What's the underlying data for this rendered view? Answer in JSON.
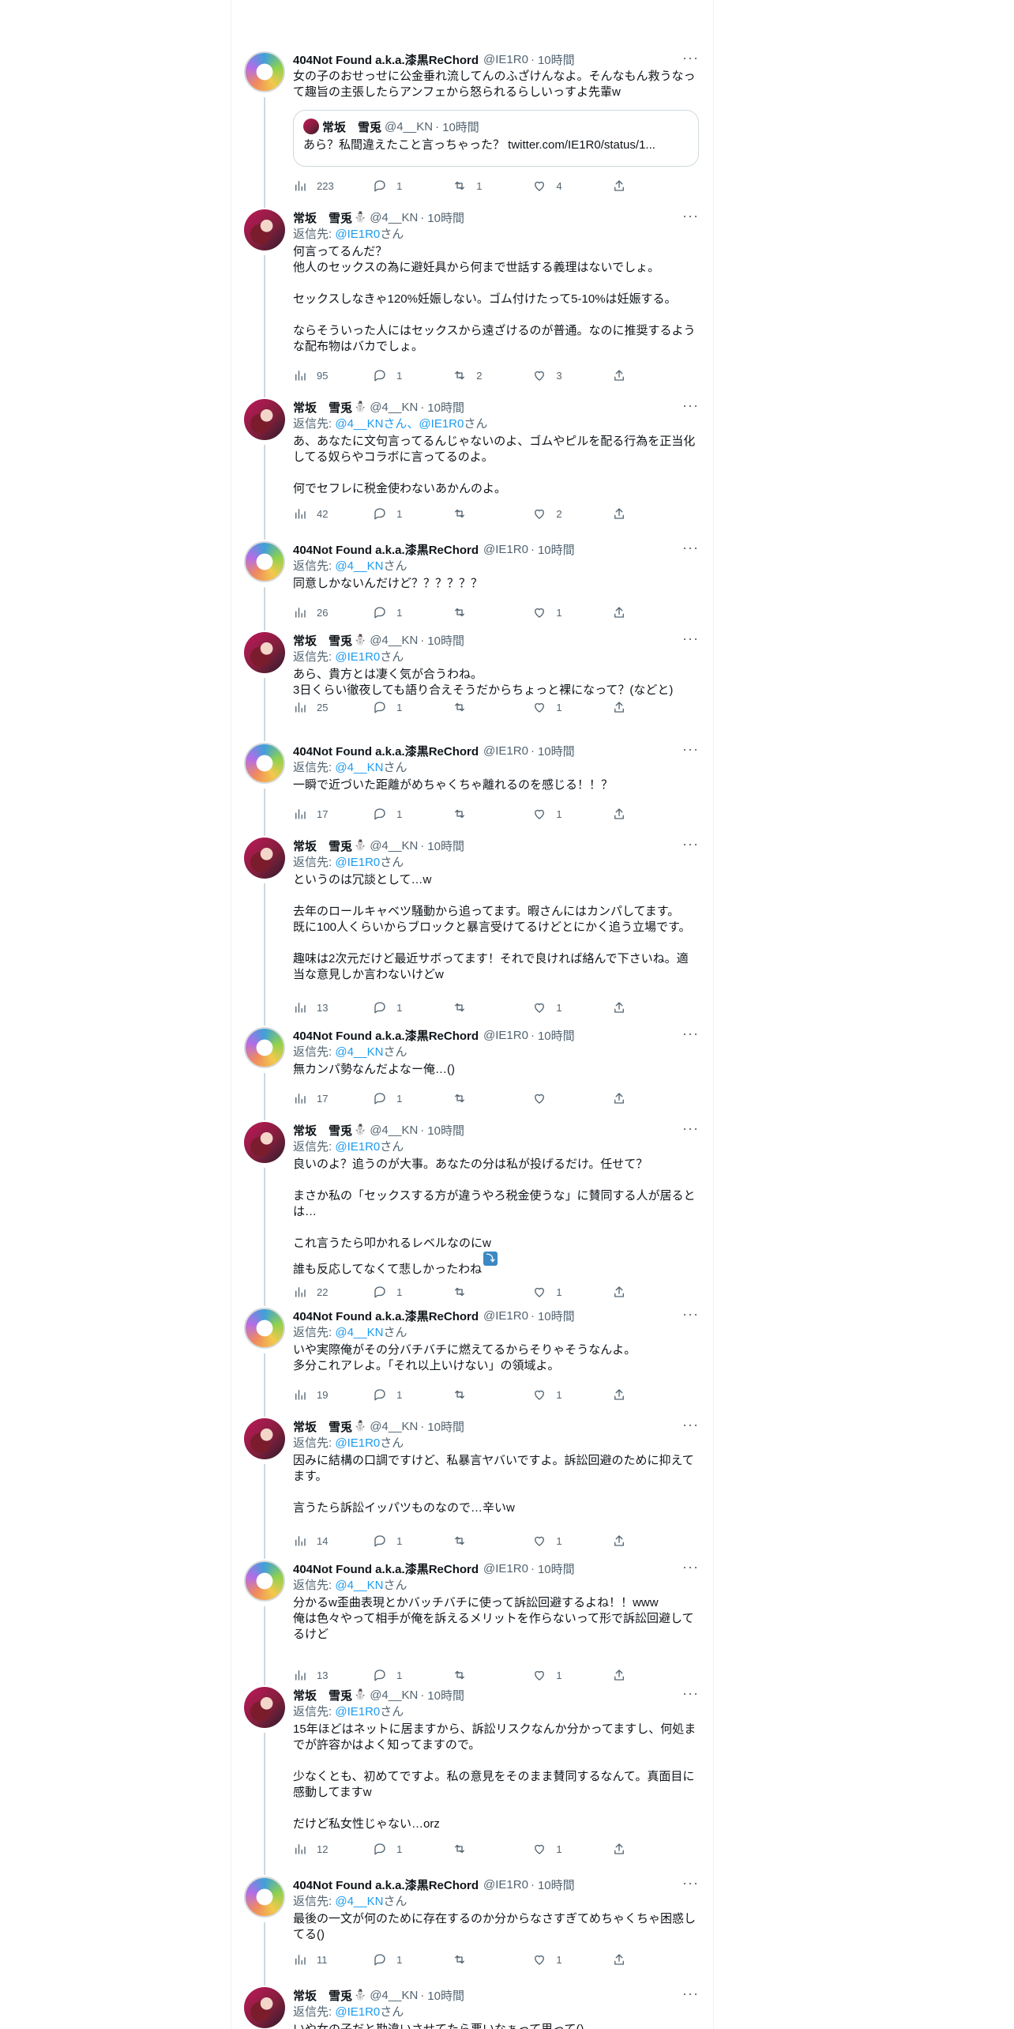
{
  "tweets": [
    {
      "name": "404Not Found a.k.a.漆黒ReChord",
      "badge": "",
      "handle": "@IE1R0",
      "time": "10時間",
      "reply_to": null,
      "text": "女の子のおせっせに公金垂れ流してんのふざけんなよ。そんなもん救うなって趣旨の主張したらアンフェから怒られるらしいっすよ先輩w",
      "quote": {
        "name": "常坂　雪兎",
        "handle": "@4__KN",
        "time": "10時間",
        "text": "あら？私間違えたこと言っちゃった？ twitter.com/IE1R0/status/1..."
      },
      "stats": {
        "views": "223",
        "replies": "1",
        "retweets": "1",
        "likes": "4"
      }
    },
    {
      "name": "常坂　雪兎",
      "badge": "⛄",
      "handle": "@4__KN",
      "time": "10時間",
      "reply_to": {
        "prefix": "返信先: ",
        "mentions": "@IE1R0",
        "suffix": "さん"
      },
      "text": "何言ってるんだ？\n他人のセックスの為に避妊具から何まで世話する義理はないでしょ。\n\nセックスしなきゃ120%妊娠しない。ゴム付けたって5-10%は妊娠する。\n\nならそういった人にはセックスから遠ざけるのが普通。なのに推奨するような配布物はバカでしょ。",
      "stats": {
        "views": "95",
        "replies": "1",
        "retweets": "2",
        "likes": "3"
      }
    },
    {
      "name": "常坂　雪兎",
      "badge": "⛄",
      "handle": "@4__KN",
      "time": "10時間",
      "reply_to": {
        "prefix": "返信先: ",
        "mentions": "@4__KNさん、@IE1R0",
        "suffix": "さん"
      },
      "text": "あ、あなたに文句言ってるんじゃないのよ、ゴムやピルを配る行為を正当化してる奴らやコラボに言ってるのよ。\n\n何でセフレに税金使わないあかんのよ。",
      "stats": {
        "views": "42",
        "replies": "1",
        "retweets": "",
        "likes": "2"
      }
    },
    {
      "name": "404Not Found a.k.a.漆黒ReChord",
      "badge": "",
      "handle": "@IE1R0",
      "time": "10時間",
      "reply_to": {
        "prefix": "返信先: ",
        "mentions": "@4__KN",
        "suffix": "さん"
      },
      "text": "同意しかないんだけど？？？？？？",
      "stats": {
        "views": "26",
        "replies": "1",
        "retweets": "",
        "likes": "1"
      }
    },
    {
      "name": "常坂　雪兎",
      "badge": "⛄",
      "handle": "@4__KN",
      "time": "10時間",
      "reply_to": {
        "prefix": "返信先: ",
        "mentions": "@IE1R0",
        "suffix": "さん"
      },
      "text": "あら、貴方とは凄く気が合うわね。\n3日くらい徹夜しても語り合えそうだからちょっと裸になって？(などと)",
      "stats": {
        "views": "25",
        "replies": "1",
        "retweets": "",
        "likes": "1"
      }
    },
    {
      "name": "404Not Found a.k.a.漆黒ReChord",
      "badge": "",
      "handle": "@IE1R0",
      "time": "10時間",
      "reply_to": {
        "prefix": "返信先: ",
        "mentions": "@4__KN",
        "suffix": "さん"
      },
      "text": "一瞬で近づいた距離がめちゃくちゃ離れるのを感じる！！？",
      "stats": {
        "views": "17",
        "replies": "1",
        "retweets": "",
        "likes": "1"
      }
    },
    {
      "name": "常坂　雪兎",
      "badge": "⛄",
      "handle": "@4__KN",
      "time": "10時間",
      "reply_to": {
        "prefix": "返信先: ",
        "mentions": "@IE1R0",
        "suffix": "さん"
      },
      "text": "というのは冗談として…w\n\n去年のロールキャベツ騒動から追ってます。暇さんにはカンパしてます。\n既に100人くらいからブロックと暴言受けてるけどとにかく追う立場です。\n\n趣味は2次元だけど最近サボってます！それで良ければ絡んで下さいね。適当な意見しか言わないけどw",
      "stats": {
        "views": "13",
        "replies": "1",
        "retweets": "",
        "likes": "1"
      }
    },
    {
      "name": "404Not Found a.k.a.漆黒ReChord",
      "badge": "",
      "handle": "@IE1R0",
      "time": "10時間",
      "reply_to": {
        "prefix": "返信先: ",
        "mentions": "@4__KN",
        "suffix": "さん"
      },
      "text": "無カンパ勢なんだよなー俺…()",
      "stats": {
        "views": "17",
        "replies": "1",
        "retweets": "",
        "likes": ""
      }
    },
    {
      "name": "常坂　雪兎",
      "badge": "⛄",
      "handle": "@4__KN",
      "time": "10時間",
      "reply_to": {
        "prefix": "返信先: ",
        "mentions": "@IE1R0",
        "suffix": "さん"
      },
      "text": "良いのよ？追うのが大事。あなたの分は私が投げるだけ。任せて？\n\nまさか私の「セックスする方が違うやろ税金使うな」に賛同する人が居るとは…\n\nこれ言うたら叩かれるレベルなのにw\n誰も反応してなくて悲しかったわね",
      "text_emoji": "⤵⤵",
      "stats": {
        "views": "22",
        "replies": "1",
        "retweets": "",
        "likes": "1"
      }
    },
    {
      "name": "404Not Found a.k.a.漆黒ReChord",
      "badge": "",
      "handle": "@IE1R0",
      "time": "10時間",
      "reply_to": {
        "prefix": "返信先: ",
        "mentions": "@4__KN",
        "suffix": "さん"
      },
      "text": "いや実際俺がその分バチバチに燃えてるからそりゃそうなんよ。\n多分これアレよ。「それ以上いけない」の領域よ。",
      "stats": {
        "views": "19",
        "replies": "1",
        "retweets": "",
        "likes": "1"
      }
    },
    {
      "name": "常坂　雪兎",
      "badge": "⛄",
      "handle": "@4__KN",
      "time": "10時間",
      "reply_to": {
        "prefix": "返信先: ",
        "mentions": "@IE1R0",
        "suffix": "さん"
      },
      "text": "因みに結構の口調ですけど、私暴言ヤバいですよ。訴訟回避のために抑えてます。\n\n言うたら訴訟イッパツものなので…辛いw",
      "stats": {
        "views": "14",
        "replies": "1",
        "retweets": "",
        "likes": "1"
      }
    },
    {
      "name": "404Not Found a.k.a.漆黒ReChord",
      "badge": "",
      "handle": "@IE1R0",
      "time": "10時間",
      "reply_to": {
        "prefix": "返信先: ",
        "mentions": "@4__KN",
        "suffix": "さん"
      },
      "text": "分かるw歪曲表現とかバッチバチに使って訴訟回避するよね！！www\n俺は色々やって相手が俺を訴えるメリットを作らないって形で訴訟回避してるけど",
      "stats": {
        "views": "13",
        "replies": "1",
        "retweets": "",
        "likes": "1"
      }
    },
    {
      "name": "常坂　雪兎",
      "badge": "⛄",
      "handle": "@4__KN",
      "time": "10時間",
      "reply_to": {
        "prefix": "返信先: ",
        "mentions": "@IE1R0",
        "suffix": "さん"
      },
      "text": "15年ほどはネットに居ますから、訴訟リスクなんか分かってますし、何処までが許容かはよく知ってますので。\n\n少なくとも、初めてですよ。私の意見をそのまま賛同するなんて。真面目に感動してますw\n\nだけど私女性じゃない…orz",
      "stats": {
        "views": "12",
        "replies": "1",
        "retweets": "",
        "likes": "1"
      }
    },
    {
      "name": "404Not Found a.k.a.漆黒ReChord",
      "badge": "",
      "handle": "@IE1R0",
      "time": "10時間",
      "reply_to": {
        "prefix": "返信先: ",
        "mentions": "@4__KN",
        "suffix": "さん"
      },
      "text": "最後の一文が何のために存在するのか分からなさすぎてめちゃくちゃ困惑してる()",
      "stats": {
        "views": "11",
        "replies": "1",
        "retweets": "",
        "likes": "1"
      }
    },
    {
      "name": "常坂　雪兎",
      "badge": "⛄",
      "handle": "@4__KN",
      "time": "10時間",
      "reply_to": {
        "prefix": "返信先: ",
        "mentions": "@IE1R0",
        "suffix": "さん"
      },
      "text": "いや女の子だと勘違いさせてたら悪いなぁって思って()",
      "stats": {
        "views": "",
        "replies": "",
        "retweets": "",
        "likes": ""
      }
    }
  ],
  "icons": {
    "more": "more-horizontal-icon",
    "views": "analytics-bar-icon",
    "reply": "reply-bubble-icon",
    "retweet": "retweet-icon",
    "like": "heart-icon",
    "share": "share-upload-icon"
  },
  "colors": {
    "text": "#0f1419",
    "secondary": "#536471",
    "link": "#1d9bf0",
    "border": "#cfd9de",
    "thread_line": "#cfd9de"
  },
  "separator": "·"
}
